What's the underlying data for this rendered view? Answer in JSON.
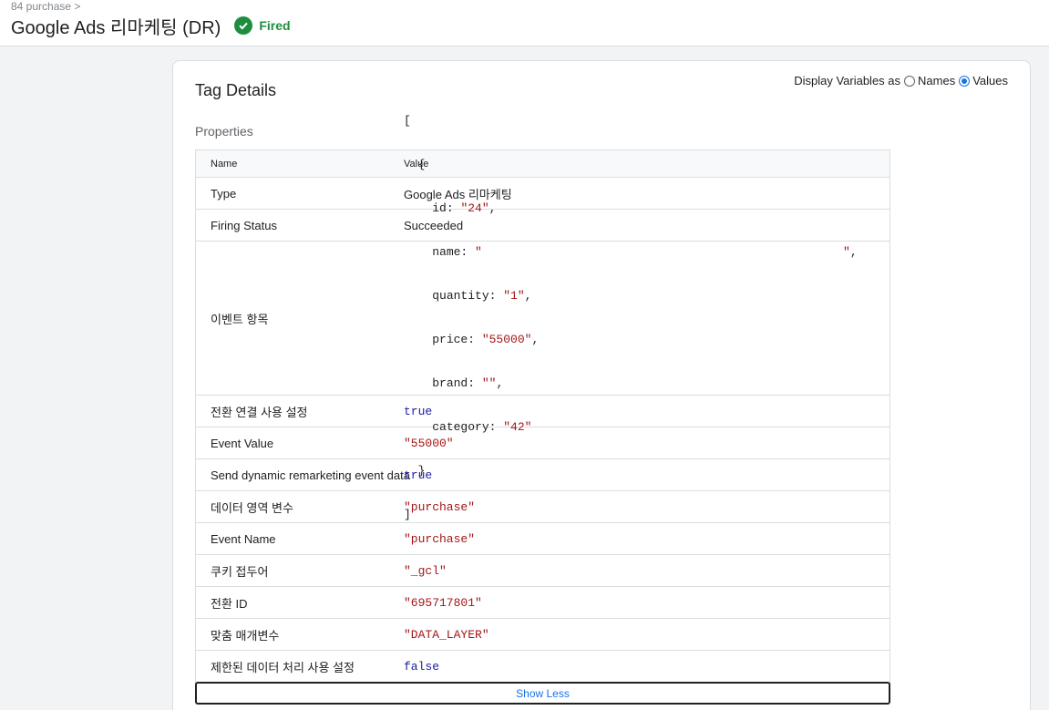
{
  "header": {
    "breadcrumb": "84 purchase >",
    "title": "Google Ads 리마케팅 (DR)",
    "status": "Fired",
    "status_icon": "check-circle-icon",
    "status_color": "#1e8e3e"
  },
  "card": {
    "title": "Tag Details",
    "display_label": "Display Variables as",
    "option_names": "Names",
    "option_values": "Values",
    "selected_option": "Values",
    "section_title": "Properties",
    "col_name": "Name",
    "col_value": "Value",
    "show_less": "Show Less"
  },
  "rows": {
    "type": {
      "name": "Type",
      "value": "Google Ads 리마케팅"
    },
    "firing": {
      "name": "Firing Status",
      "value": "Succeeded"
    },
    "event_items": {
      "name": "이벤트 항목",
      "json": {
        "open_bracket": "[",
        "open_brace": "{",
        "id_key": "id: ",
        "id_val": "\"24\"",
        "name_key": "name: ",
        "name_val_open": "\"",
        "name_val_close": "\"",
        "quantity_key": "quantity: ",
        "quantity_val": "\"1\"",
        "price_key": "price: ",
        "price_val": "\"55000\"",
        "brand_key": "brand: ",
        "brand_val": "\"\"",
        "category_key": "category: ",
        "category_val": "\"42\"",
        "close_brace": "}",
        "close_bracket": "]",
        "comma": ","
      }
    },
    "conversion_linker": {
      "name": "전환 연결 사용 설정",
      "value": "true"
    },
    "event_value": {
      "name": "Event Value",
      "value": "\"55000\""
    },
    "dynamic_remarketing": {
      "name": "Send dynamic remarketing event data",
      "value": "true"
    },
    "data_layer_var": {
      "name": "데이터 영역 변수",
      "value": "\"purchase\""
    },
    "event_name": {
      "name": "Event Name",
      "value": "\"purchase\""
    },
    "cookie_prefix": {
      "name": "쿠키 접두어",
      "value": "\"_gcl\""
    },
    "conversion_id": {
      "name": "전환 ID",
      "value": "\"695717801\""
    },
    "custom_params": {
      "name": "맞춤 매개변수",
      "value": "\"DATA_LAYER\""
    },
    "restricted_data": {
      "name": "제한된 데이터 처리 사용 설정",
      "value": "false"
    }
  }
}
